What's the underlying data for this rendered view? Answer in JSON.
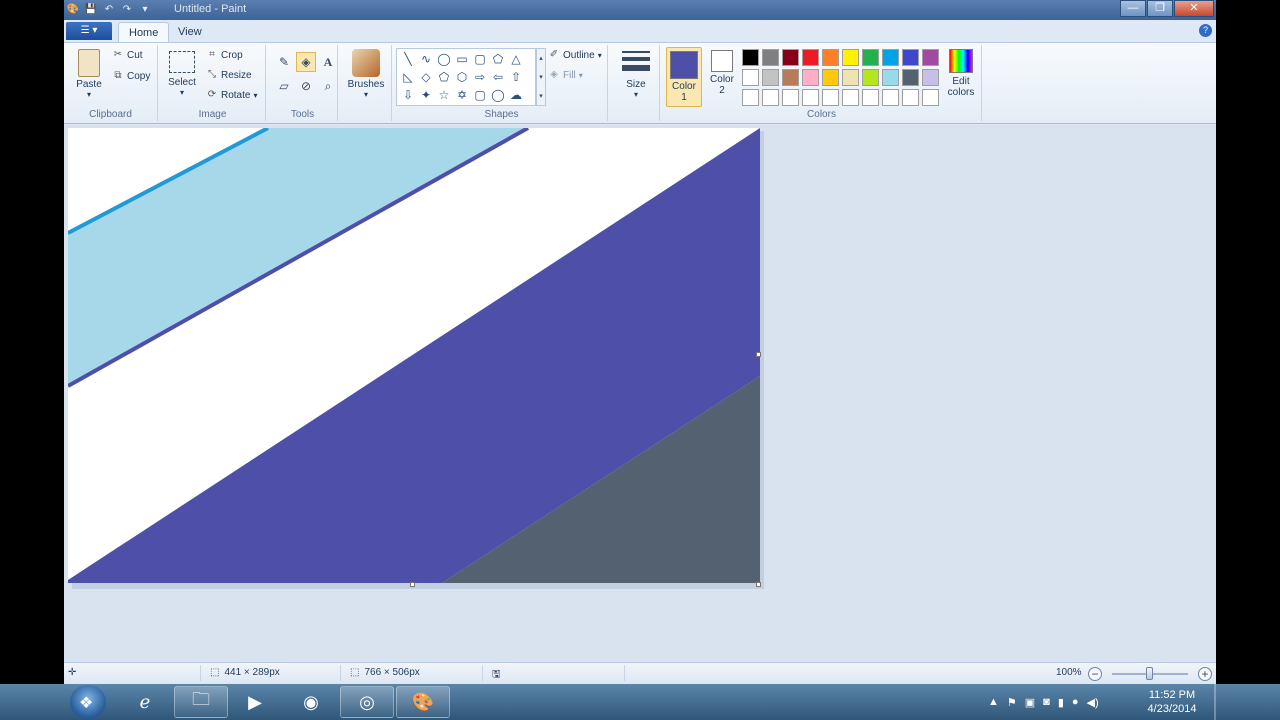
{
  "window": {
    "title": "Untitled - Paint",
    "min_glyph": "—",
    "max_glyph": "❐",
    "close_glyph": "✕"
  },
  "tabs": {
    "home": "Home",
    "view": "View"
  },
  "ribbon": {
    "clipboard": {
      "label": "Clipboard",
      "paste": "Paste",
      "cut": "Cut",
      "copy": "Copy"
    },
    "image": {
      "label": "Image",
      "select": "Select",
      "crop": "Crop",
      "resize": "Resize",
      "rotate": "Rotate"
    },
    "tools": {
      "label": "Tools"
    },
    "brushes": {
      "label": "Brushes"
    },
    "shapes": {
      "label": "Shapes",
      "outline": "Outline",
      "fill": "Fill"
    },
    "size": {
      "label": "Size"
    },
    "colors": {
      "label": "Colors",
      "color1_label": "Color",
      "color1_num": "1",
      "color2_label": "Color",
      "color2_num": "2",
      "edit_label": "Edit",
      "edit_label2": "colors",
      "color1": "#4e4fa8",
      "color2": "#ffffff",
      "palette_row1": [
        "#000000",
        "#7f7f7f",
        "#880015",
        "#ed1c24",
        "#ff7f27",
        "#fff200",
        "#22b14c",
        "#00a2e8",
        "#3f48cc",
        "#a349a4"
      ],
      "palette_row2": [
        "#ffffff",
        "#c3c3c3",
        "#b97a57",
        "#ffaec9",
        "#ffc90e",
        "#efe4b0",
        "#b5e61d",
        "#99d9ea",
        "#546170",
        "#c8bfe7"
      ],
      "palette_row3": [
        "#ffffff",
        "#ffffff",
        "#ffffff",
        "#ffffff",
        "#ffffff",
        "#ffffff",
        "#ffffff",
        "#ffffff",
        "#ffffff",
        "#ffffff"
      ]
    }
  },
  "canvas": {
    "colors": {
      "light_blue": "#a6d8ea",
      "blue_line": "#1f9ad6",
      "indigo": "#4e4fa8",
      "slate": "#546170",
      "white": "#ffffff"
    }
  },
  "status": {
    "selection_size": "441 × 289px",
    "canvas_size": "766 × 506px",
    "zoom": "100%",
    "zoom_out": "−",
    "zoom_in": "+"
  },
  "taskbar": {
    "time": "11:52 PM",
    "date": "4/23/2014"
  }
}
